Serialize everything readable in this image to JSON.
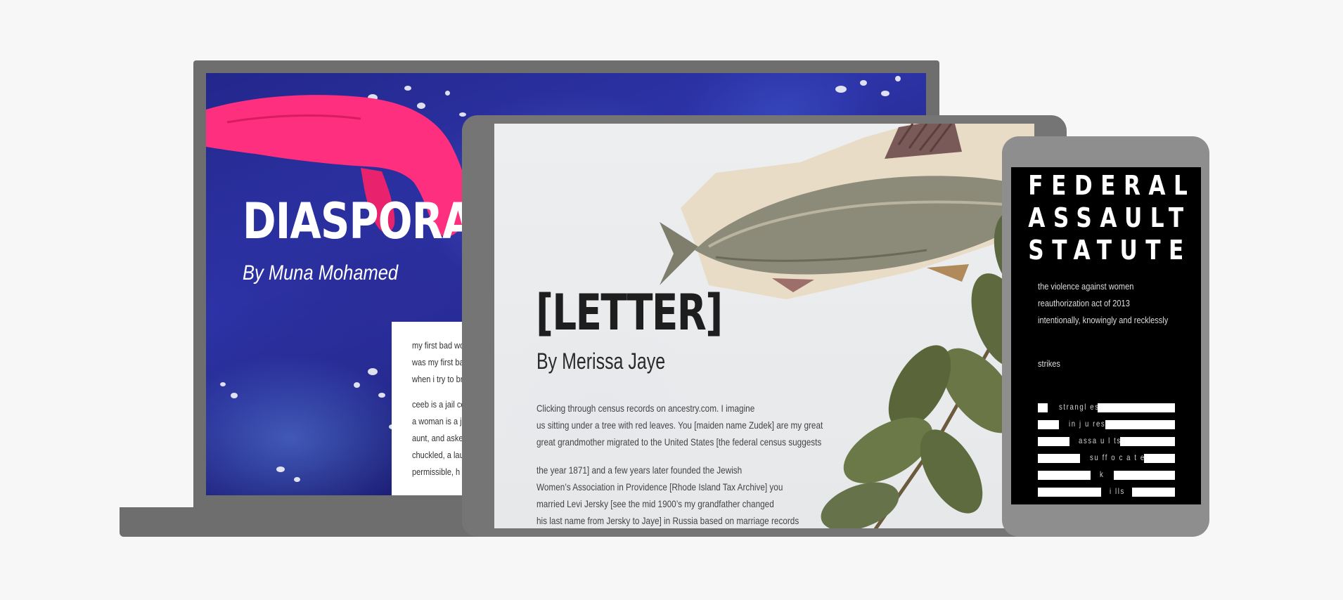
{
  "laptop": {
    "title": "DIASPORA",
    "byline": "By Muna Mohamed",
    "paragraphs": [
      [
        "my first bad wo",
        "was my first ba",
        "when i try to br"
      ],
      [
        "ceeb is a jail ce",
        "a woman is a je",
        "aunt, and aske",
        "chuckled, a lau",
        "permissible, h"
      ]
    ]
  },
  "tablet": {
    "title": "[LETTER]",
    "byline": "By Merissa Jaye",
    "paragraphs": [
      [
        "Clicking through census records on ancestry.com. I imagine",
        "us sitting under a tree with red leaves. You [maiden name Zudek] are my great",
        "great grandmother migrated to the United States [the federal census suggests"
      ],
      [
        "the year 1871] and a few years later founded the Jewish",
        "Women’s Association in Providence [Rhode Island Tax Archive] you",
        "married Levi Jersky [see the mid 1900’s my grandfather changed",
        "his last name from Jersky to Jaye] in Russia based on marriage records"
      ]
    ]
  },
  "phone": {
    "title_lines": [
      "FEDERAL",
      "ASSAULT",
      "STATUTE"
    ],
    "intro_lines": [
      "the violence against women",
      "reauthorization act of 2013",
      "intentionally, knowingly and recklessly"
    ],
    "strikes": "strikes",
    "redacted_words": [
      "strangl es",
      "in j u res",
      "assa u l ts",
      "su ff o c a t e s",
      "k",
      "i lls"
    ]
  },
  "colors": {
    "background": "#f7f7f7",
    "device_gray": "#6e6e6e",
    "diaspora_blue": "#262c96",
    "hand_pink": "#ff2f7f",
    "phone_black": "#000000"
  }
}
